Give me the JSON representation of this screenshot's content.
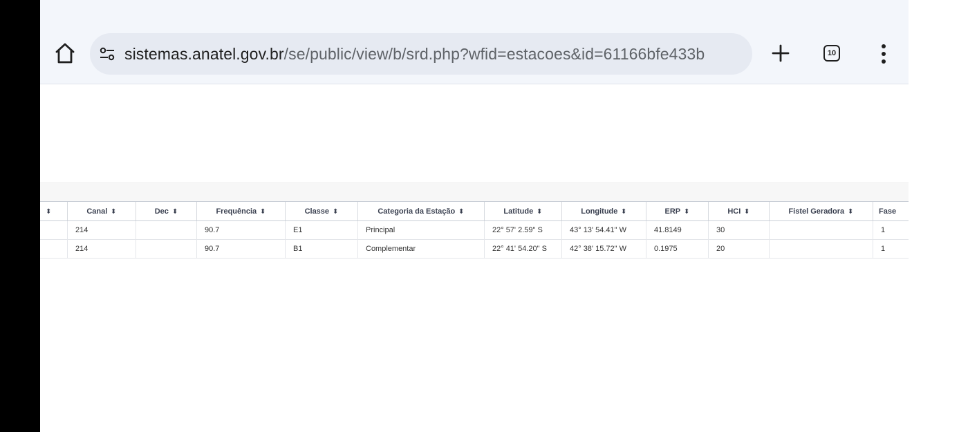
{
  "browser": {
    "url_host": "sistemas.anatel.gov.br",
    "url_path": "/se/public/view/b/srd.php?wfid=estacoes&id=61166bfe433b",
    "tab_count": "10",
    "icons": {
      "home": "home-icon",
      "site_settings": "tune-icon",
      "new_tab": "plus-icon",
      "tabs": "tab-switcher-icon",
      "menu": "more-vert-icon"
    }
  },
  "table": {
    "sort_glyph": "⬍",
    "columns": [
      "",
      "Canal",
      "Dec",
      "Frequência",
      "Classe",
      "Categoria da Estação",
      "Latitude",
      "Longitude",
      "ERP",
      "HCI",
      "Fistel Geradora",
      "Fase"
    ],
    "rows": [
      [
        "",
        "214",
        "",
        "90.7",
        "E1",
        "Principal",
        "22° 57' 2.59\" S",
        "43° 13' 54.41\" W",
        "41.8149",
        "30",
        "",
        "1"
      ],
      [
        "",
        "214",
        "",
        "90.7",
        "B1",
        "Complementar",
        "22° 41' 54.20\" S",
        "42° 38' 15.72\" W",
        "0.1975",
        "20",
        "",
        "1"
      ]
    ]
  },
  "colors": {
    "toolbar_bg": "#f3f6fb",
    "omnibox_bg": "#e6eaf2",
    "text_primary": "#1f1f1f",
    "text_secondary": "#5f6368"
  }
}
